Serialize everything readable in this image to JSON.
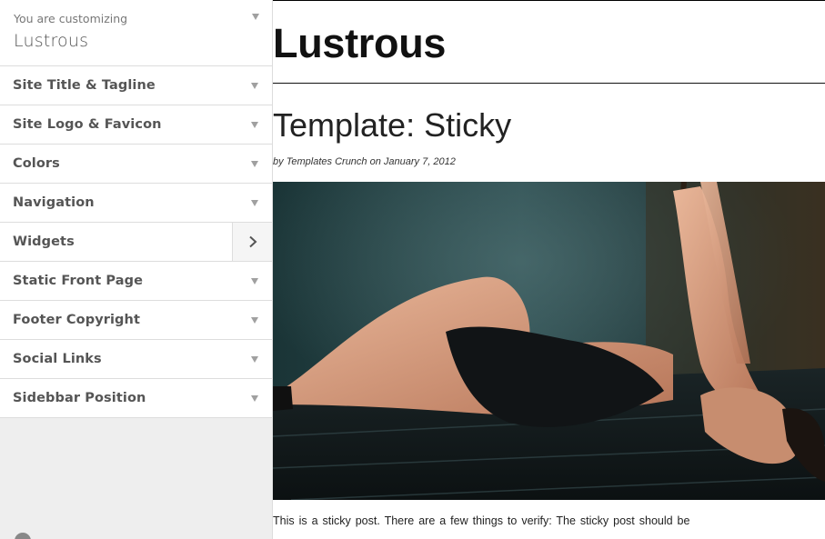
{
  "sidebar": {
    "preview_notice": "You are customizing",
    "theme_name": "Lustrous",
    "sections": [
      {
        "label": "Site Title & Tagline",
        "icon": "chevron-down-icon"
      },
      {
        "label": "Site Logo & Favicon",
        "icon": "chevron-down-icon"
      },
      {
        "label": "Colors",
        "icon": "chevron-down-icon"
      },
      {
        "label": "Navigation",
        "icon": "chevron-down-icon"
      },
      {
        "label": "Widgets",
        "icon": "chevron-right-icon"
      },
      {
        "label": "Static Front Page",
        "icon": "chevron-down-icon"
      },
      {
        "label": "Footer Copyright",
        "icon": "chevron-down-icon"
      },
      {
        "label": "Social Links",
        "icon": "chevron-down-icon"
      },
      {
        "label": "Sidebbar Position",
        "icon": "chevron-down-icon"
      }
    ]
  },
  "preview": {
    "site_title": "Lustrous",
    "post": {
      "title": "Template: Sticky",
      "meta_by": "by",
      "author": "Templates Crunch",
      "meta_on": "on",
      "date": "January 7, 2012",
      "excerpt": "This is a sticky post. There are a few things to verify: The sticky post should be"
    }
  },
  "colors": {
    "sidebar_bg": "#eeeeee",
    "section_bg": "#ffffff",
    "border": "#dddddd",
    "section_text": "#555555",
    "arrow": "#a0a0a0",
    "title_text": "#111111"
  }
}
